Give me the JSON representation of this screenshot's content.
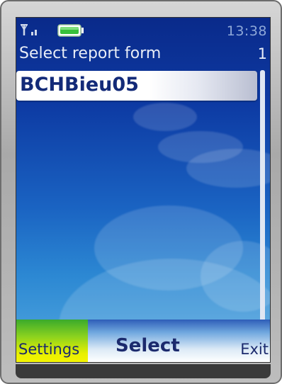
{
  "status_bar": {
    "time": "13:38",
    "signal_icon": "signal-strength-icon",
    "battery_icon": "battery-icon"
  },
  "header": {
    "title": "Select report form",
    "count": "1"
  },
  "list": {
    "items": [
      {
        "label": "BCHBieu05"
      }
    ]
  },
  "softkeys": {
    "left": "Settings",
    "middle": "Select",
    "right": "Exit"
  },
  "colors": {
    "screen_top": "#0a2a8a",
    "screen_bottom": "#54a9df",
    "highlight_text": "#132a78",
    "left_softkey_bg": "#e8f000"
  }
}
